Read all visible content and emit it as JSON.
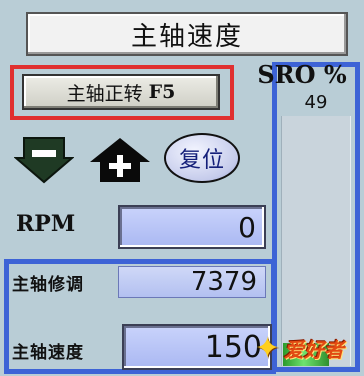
{
  "window": {
    "title": "主轴速度"
  },
  "spindle_forward": {
    "label": "主轴正转",
    "hotkey": "F5"
  },
  "sro": {
    "label": "SRO %",
    "value": "49",
    "level_fraction": 0.09,
    "fill_color": "#3ad63a"
  },
  "controls": {
    "decrease_icon": "minus-down-arrow-icon",
    "increase_icon": "plus-up-arrow-icon",
    "reset_label": "复位"
  },
  "rpm": {
    "label": "RPM",
    "value": "0"
  },
  "override": {
    "label": "主轴修调",
    "value": "7379"
  },
  "speed": {
    "label": "主轴速度",
    "value": "150"
  },
  "watermark": {
    "text": "爱好者"
  },
  "colors": {
    "panel_bg": "#b9cdd6",
    "highlight_red": "#e03030",
    "highlight_blue": "#3d63d6",
    "readout_blue": "#aab8f2"
  }
}
